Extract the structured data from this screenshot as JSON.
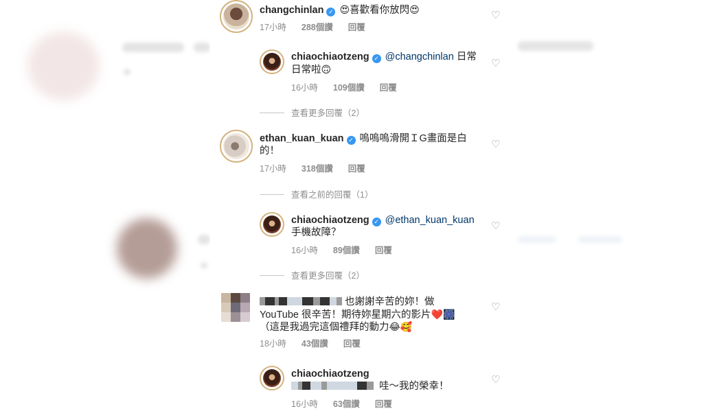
{
  "comments": [
    {
      "username": "changchinlan",
      "verified": true,
      "text_prefix_emoji": "😍",
      "text": "喜歡看你放閃",
      "text_suffix_emoji": "😍",
      "time": "17小時",
      "likes": "288個讚",
      "reply": "回覆",
      "heart_icon": "heart-outline-icon"
    },
    {
      "username": "chiaochiaotzeng",
      "verified": true,
      "mention": "@changchinlan",
      "text_line1": "日常",
      "text_line2": "日常啦",
      "text_emoji": "🙃",
      "time": "16小時",
      "likes": "109個讚",
      "reply": "回覆"
    },
    {
      "view_more": "查看更多回覆（2）"
    },
    {
      "username": "ethan_kuan_kuan",
      "verified": true,
      "text_line1": "嗚嗚嗚滑開ＩG畫面是白",
      "text_line2": "的！",
      "time": "17小時",
      "likes": "318個讚",
      "reply": "回覆"
    },
    {
      "view_prev": "查看之前的回覆（1）"
    },
    {
      "username": "chiaochiaotzeng",
      "verified": true,
      "mention": "@ethan_kuan_kuan",
      "text_line2": "手機故障？",
      "time": "16小時",
      "likes": "89個讚",
      "reply": "回覆"
    },
    {
      "view_more": "查看更多回覆（2）"
    },
    {
      "text_line1": "也謝謝辛苦的妳！做",
      "text_line2": "YouTube 很辛苦！期待妳星期六的影片",
      "text_line2_emoji": "❤️🎆",
      "text_line3": "（這是我過完這個禮拜的動力",
      "text_line3_emoji": "😂🥰",
      "time": "18小時",
      "likes": "43個讚",
      "reply": "回覆"
    },
    {
      "username": "chiaochiaotzeng",
      "text": "哇～我的榮幸！",
      "time": "16小時",
      "likes": "63個讚",
      "reply": "回覆"
    }
  ]
}
